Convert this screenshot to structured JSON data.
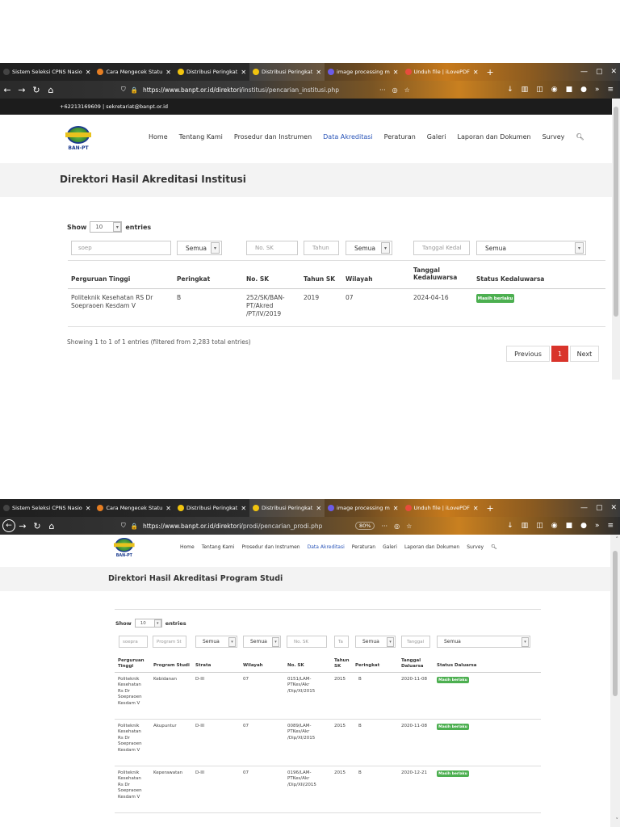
{
  "browser_tabs": [
    {
      "label": "Sistem Seleksi CPNS Nasio",
      "color": "#1f1f1f"
    },
    {
      "label": "Cara Mengecek Statu",
      "color": "#e67e22"
    },
    {
      "label": "Distribusi Peringkat",
      "color": "#f1c40f"
    },
    {
      "label": "Distribusi Peringkat",
      "color": "#f1c40f"
    },
    {
      "label": "image processing m",
      "color": "#6c5ce7"
    },
    {
      "label": "Unduh file | iLovePDF",
      "color": "#e74c3c"
    }
  ],
  "shot1": {
    "url_prefix": "https://www.banpt.or.id/direktori/",
    "url_rest": "institusi/pencarian_institusi.php",
    "contact": "+62213169609  |  sekretariat@banpt.or.id",
    "logo_text": "BAN-PT",
    "menu": [
      "Home",
      "Tentang Kami",
      "Prosedur dan Instrumen",
      "Data Akreditasi",
      "Peraturan",
      "Galeri",
      "Laporan dan Dokumen",
      "Survey"
    ],
    "page_title": "Direktori Hasil Akreditasi Institusi",
    "show_label": "Show",
    "show_value": "10",
    "entries_label": "entries",
    "filters": {
      "search_value": "soep",
      "peringkat": "Semua",
      "nosk_placeholder": "No. SK",
      "tahun_placeholder": "Tahun",
      "wilayah": "Semua",
      "tanggal_placeholder": "Tanggal Kedal",
      "status": "Semua"
    },
    "headers": [
      "Perguruan Tinggi",
      "Peringkat",
      "No. SK",
      "Tahun SK",
      "Wilayah",
      "Tanggal Kedaluwarsa",
      "Status Kedaluwarsa"
    ],
    "row": {
      "pt": "Politeknik Kesehatan RS Dr Soepraoen Kesdam V",
      "peringkat": "B",
      "nosk": "252/SK/BAN-PT/Akred /PT/IV/2019",
      "tahun": "2019",
      "wilayah": "07",
      "tanggal": "2024-04-16",
      "status": "Masih berlaku"
    },
    "info": "Showing 1 to 1 of 1 entries (filtered from 2,283 total entries)",
    "pagination": {
      "prev": "Previous",
      "current": "1",
      "next": "Next"
    }
  },
  "shot2": {
    "url_prefix": "https://www.banpt.or.id/direktori/",
    "url_rest": "prodi/pencarian_prodi.php",
    "zoom": "80%",
    "logo_text": "BAN-PT",
    "menu": [
      "Home",
      "Tentang Kami",
      "Prosedur dan Instrumen",
      "Data Akreditasi",
      "Peraturan",
      "Galeri",
      "Laporan dan Dokumen",
      "Survey"
    ],
    "page_title": "Direktori Hasil Akreditasi Program Studi",
    "show_label": "Show",
    "show_value": "10",
    "entries_label": "entries",
    "filters": {
      "search_value": "soepra",
      "prodi_placeholder": "Program St",
      "strata": "Semua",
      "wilayah": "Semua",
      "nosk_placeholder": "No. SK",
      "tahun_placeholder": "Ta",
      "peringkat": "Semua",
      "tanggal_placeholder": "Tanggal",
      "status": "Semua"
    },
    "headers": [
      "Perguruan Tinggi",
      "Program Studi",
      "Strata",
      "Wilayah",
      "No. SK",
      "Tahun SK",
      "Peringkat",
      "Tanggal Daluarsa",
      "Status Daluarsa"
    ],
    "rows": [
      {
        "pt": "Politeknik Kesehatan Rs Dr Soepraoen Kesdam V",
        "prodi": "Kebidanan",
        "strata": "D-III",
        "wilayah": "07",
        "nosk": "0151/LAM-PTKes/Akr /Dip/XI/2015",
        "tahun": "2015",
        "peringkat": "B",
        "tanggal": "2020-11-08",
        "status": "Masih berlaku"
      },
      {
        "pt": "Politeknik Kesehatan Rs Dr Soepraoen Kesdam V",
        "prodi": "Akupuntur",
        "strata": "D-III",
        "wilayah": "07",
        "nosk": "0089/LAM-PTKes/Akr /Dip/XI/2015",
        "tahun": "2015",
        "peringkat": "B",
        "tanggal": "2020-11-08",
        "status": "Masih berlaku"
      },
      {
        "pt": "Politeknik Kesehatan Rs Dr Soepraoen Kesdam V",
        "prodi": "Keperawatan",
        "strata": "D-III",
        "wilayah": "07",
        "nosk": "0196/LAM-PTKes/Akr /Dip/XII/2015",
        "tahun": "2015",
        "peringkat": "B",
        "tanggal": "2020-12-21",
        "status": "Masih berlaku"
      }
    ]
  }
}
